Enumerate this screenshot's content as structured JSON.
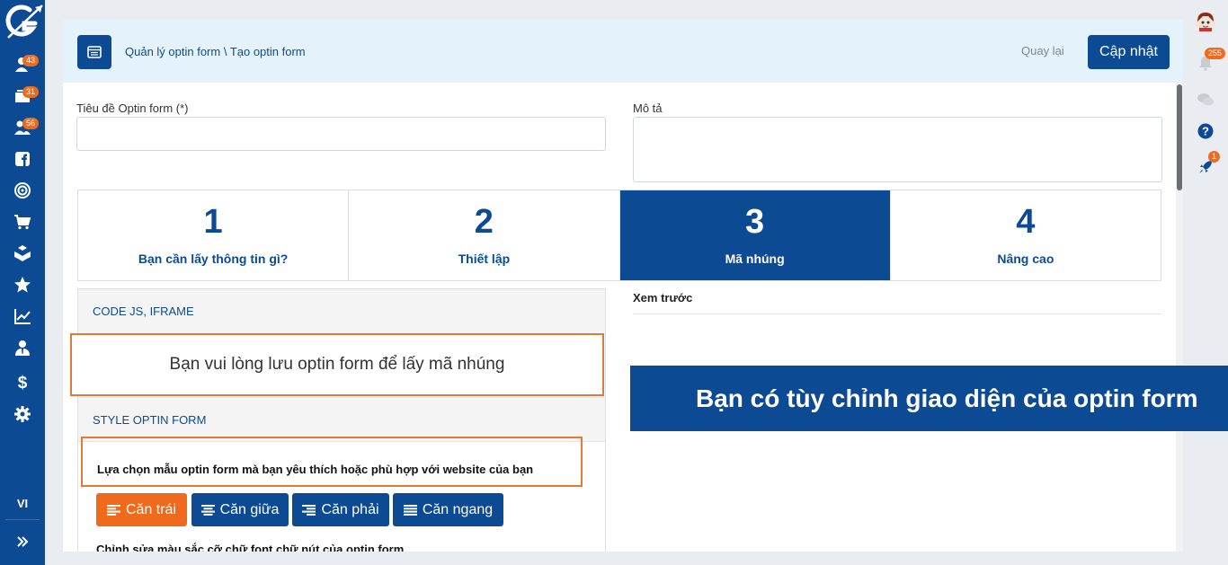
{
  "sidebar": {
    "badges": {
      "contacts": "43",
      "inbox": "31",
      "users": "56"
    },
    "language": "VI"
  },
  "rail": {
    "notifications_badge": "255",
    "rocket_badge": "1"
  },
  "header": {
    "breadcrumb": "Quản lý optin form \\ Tạo optin form",
    "back_label": "Quay lại",
    "update_label": "Cập nhật"
  },
  "form": {
    "title_label": "Tiêu đề Optin form (*)",
    "title_value": "",
    "description_label": "Mô tả",
    "description_value": ""
  },
  "steps": [
    {
      "number": "1",
      "label": "Bạn cần lấy thông tin gì?"
    },
    {
      "number": "2",
      "label": "Thiết lập"
    },
    {
      "number": "3",
      "label": "Mã nhúng"
    },
    {
      "number": "4",
      "label": "Nâng cao"
    }
  ],
  "active_step": 3,
  "sections": {
    "code_heading": "CODE JS, IFRAME",
    "code_message": "Bạn vui lòng lưu optin form để lấy mã nhúng",
    "style_heading": "STYLE OPTIN FORM",
    "style_instruction": "Lựa chọn mẫu optin form mà bạn yêu thích hoặc phù hợp với website của bạn",
    "align_buttons": [
      "Căn trái",
      "Căn giữa",
      "Căn phải",
      "Căn ngang"
    ],
    "selected_align": "Căn trái",
    "color_instruction": "Chỉnh sửa màu sắc cỡ chữ font chữ nút của optin form"
  },
  "preview": {
    "label": "Xem trước"
  },
  "banner": {
    "text": "Bạn có tùy chỉnh giao diện của optin form"
  },
  "colors": {
    "primary": "#0d4a94",
    "accent": "#f06a1d",
    "highlight_border": "#e07a35",
    "topbar_bg": "#e4f3fb"
  },
  "icons": {
    "sidebar": [
      "logo-icon",
      "contacts-icon",
      "inbox-icon",
      "users-icon",
      "facebook-icon",
      "target-icon",
      "cart-icon",
      "boxes-icon",
      "star-icon",
      "chart-icon",
      "user-tie-icon",
      "dollar-icon",
      "gear-icon",
      "expand-icon"
    ],
    "rail": [
      "avatar",
      "bell-icon",
      "chat-icon",
      "help-icon",
      "rocket-icon"
    ]
  }
}
